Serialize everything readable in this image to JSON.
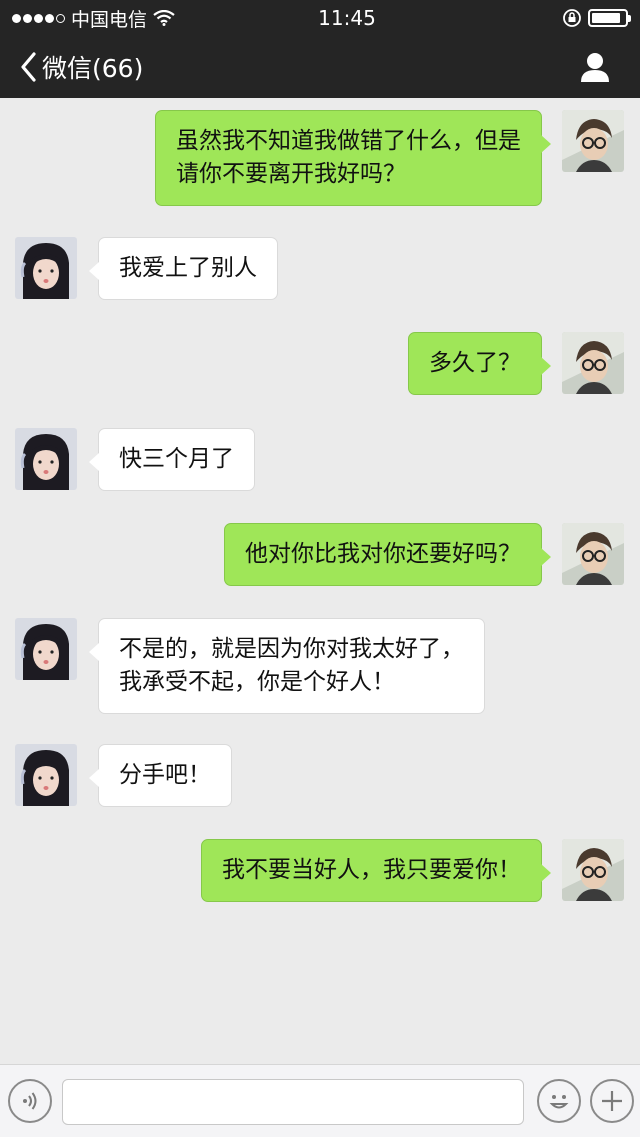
{
  "status_bar": {
    "carrier": "中国电信",
    "time": "11:45",
    "battery_level": 0.9
  },
  "nav": {
    "back_title": "微信(66)"
  },
  "messages": [
    {
      "side": "right",
      "lines": [
        "虽然我不知道我做错了什么，但是",
        "请你不要离开我好吗？"
      ]
    },
    {
      "side": "left",
      "lines": [
        "我爱上了别人"
      ]
    },
    {
      "side": "right",
      "lines": [
        "多久了？"
      ]
    },
    {
      "side": "left",
      "lines": [
        "快三个月了"
      ]
    },
    {
      "side": "right",
      "lines": [
        "他对你比我对你还要好吗？"
      ]
    },
    {
      "side": "left",
      "lines": [
        "不是的，就是因为你对我太好了，",
        "我承受不起，你是个好人！"
      ]
    },
    {
      "side": "left",
      "lines": [
        "分手吧！"
      ]
    },
    {
      "side": "right",
      "lines": [
        "我不要当好人，我只要爱你！"
      ]
    }
  ],
  "input": {
    "value": "",
    "placeholder": ""
  },
  "colors": {
    "bar_bg": "#252525",
    "chat_bg": "#ebebeb",
    "outgoing_bubble": "#9fe658",
    "incoming_bubble": "#ffffff"
  },
  "icons": {
    "back": "chevron-left-icon",
    "profile": "person-icon",
    "voice": "voice-icon",
    "emoji": "emoji-icon",
    "more": "plus-icon"
  }
}
